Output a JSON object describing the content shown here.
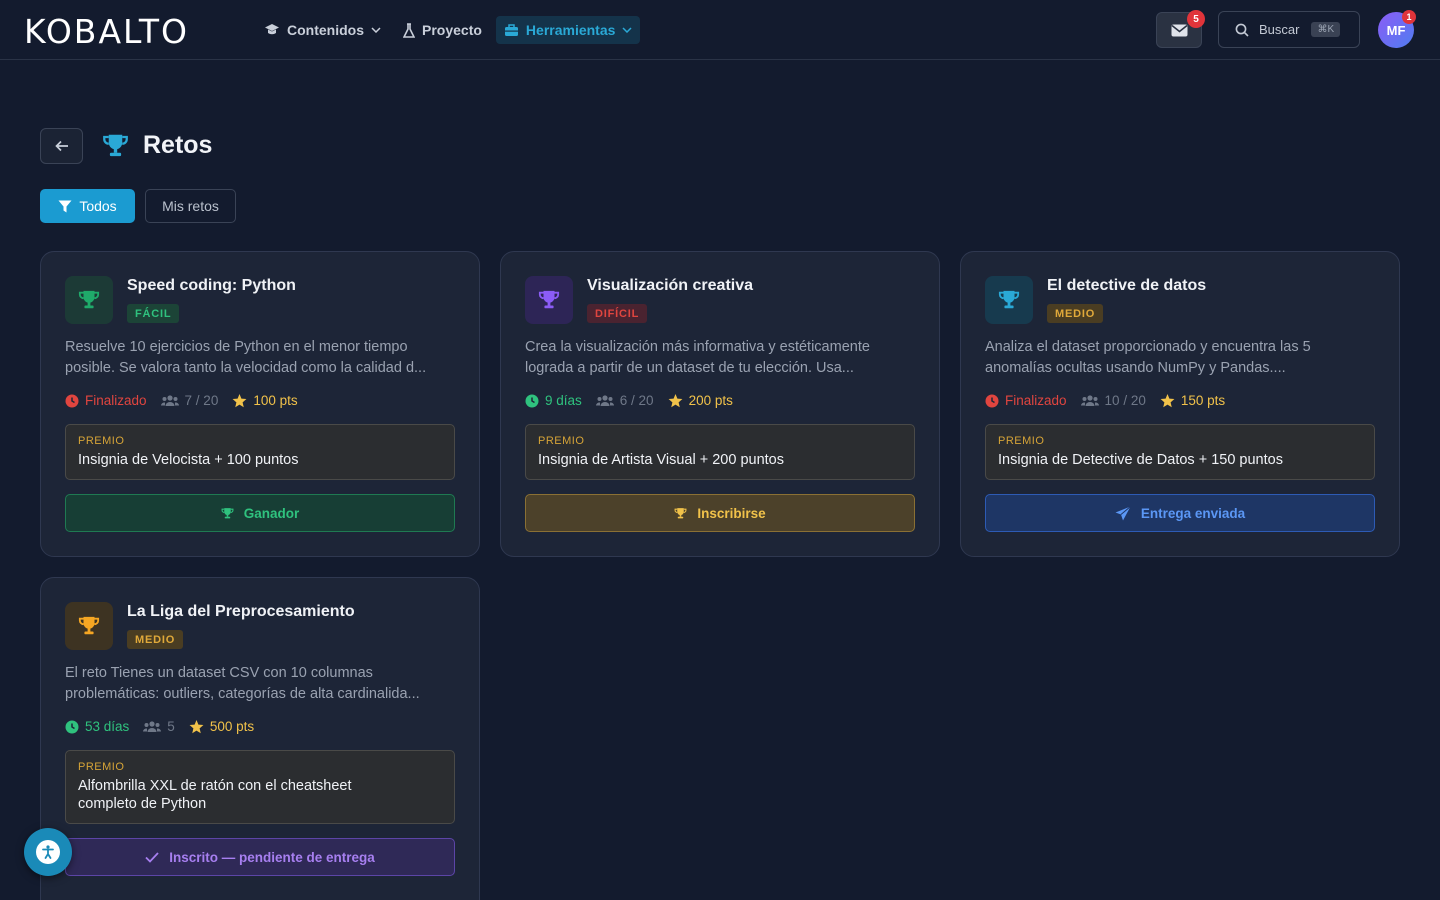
{
  "header": {
    "logo": "KOBALTO",
    "nav": [
      {
        "label": "Contenidos"
      },
      {
        "label": "Proyecto"
      },
      {
        "label": "Herramientas"
      }
    ],
    "mail_badge": "5",
    "search_label": "Buscar",
    "search_shortcut": "⌘K",
    "avatar_initials": "MF",
    "avatar_badge": "1"
  },
  "page": {
    "title": "Retos",
    "filters": {
      "all": "Todos",
      "mine": "Mis retos"
    }
  },
  "cards": [
    {
      "title": "Speed coding: Python",
      "difficulty": "FÁCIL",
      "description": "Resuelve 10 ejercicios de Python en el menor tiempo posible. Se valora tanto la velocidad como la calidad d...",
      "status": "Finalizado",
      "participants": "7 / 20",
      "points": "100 pts",
      "prize_label": "PREMIO",
      "prize": "Insignia de Velocista + 100 puntos",
      "action": "Ganador"
    },
    {
      "title": "Visualización creativa",
      "difficulty": "DIFÍCIL",
      "description": "Crea la visualización más informativa y estéticamente lograda a partir de un dataset de tu elección. Usa...",
      "status": "9 días",
      "participants": "6 / 20",
      "points": "200 pts",
      "prize_label": "PREMIO",
      "prize": "Insignia de Artista Visual + 200 puntos",
      "action": "Inscribirse"
    },
    {
      "title": "El detective de datos",
      "difficulty": "MEDIO",
      "description": "Analiza el dataset proporcionado y encuentra las 5 anomalías ocultas usando NumPy y Pandas....",
      "status": "Finalizado",
      "participants": "10 / 20",
      "points": "150 pts",
      "prize_label": "PREMIO",
      "prize": "Insignia de Detective de Datos + 150 puntos",
      "action": "Entrega enviada"
    },
    {
      "title": "La Liga del Preprocesamiento",
      "difficulty": "MEDIO",
      "description": "El reto Tienes un dataset CSV con 10 columnas problemáticas: outliers, categorías de alta cardinalida...",
      "status": "53 días",
      "participants": "5",
      "points": "500 pts",
      "prize_label": "PREMIO",
      "prize": "Alfombrilla XXL de ratón con el cheatsheet completo de Python",
      "action": "Inscrito — pendiente de entrega"
    }
  ],
  "colors": {
    "background": "#131b2e",
    "card": "#1d2537",
    "accent": "#1b9bd1",
    "easy": "#2fc27e",
    "hard": "#e0453f",
    "medium": "#e0a93a",
    "finished": "#e0453f",
    "active": "#2fc27e"
  }
}
